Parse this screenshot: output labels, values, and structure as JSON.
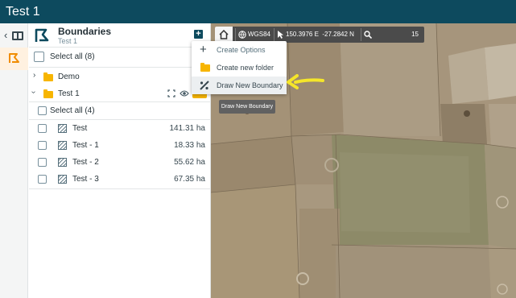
{
  "window": {
    "title": "Test 1"
  },
  "panel": {
    "title": "Boundaries",
    "subtitle": "Test 1",
    "add_label": "+",
    "select_all_label": "Select all (8)",
    "folders": [
      {
        "name": "Demo"
      },
      {
        "name": "Test 1"
      }
    ],
    "sub_select_all_label": "Select all (4)",
    "boundaries": [
      {
        "name": "Test",
        "area": "141.31 ha"
      },
      {
        "name": "Test - 1",
        "area": "18.33 ha"
      },
      {
        "name": "Test - 2",
        "area": "55.62 ha"
      },
      {
        "name": "Test - 3",
        "area": "67.35 ha"
      }
    ]
  },
  "map_toolbar": {
    "projection": "WGS84",
    "coordinates": "150.3976 E  -27.2842 N",
    "zoom": "15"
  },
  "create_menu": {
    "header": "Create Options",
    "items": [
      {
        "label": "Create new folder"
      },
      {
        "label": "Draw New Boundary"
      }
    ]
  },
  "tooltip": {
    "text": "Draw New Boundary"
  },
  "colors": {
    "titlebar": "#0d4a5e",
    "accent": "#f7b500",
    "annotation_arrow": "#f5e62a"
  }
}
